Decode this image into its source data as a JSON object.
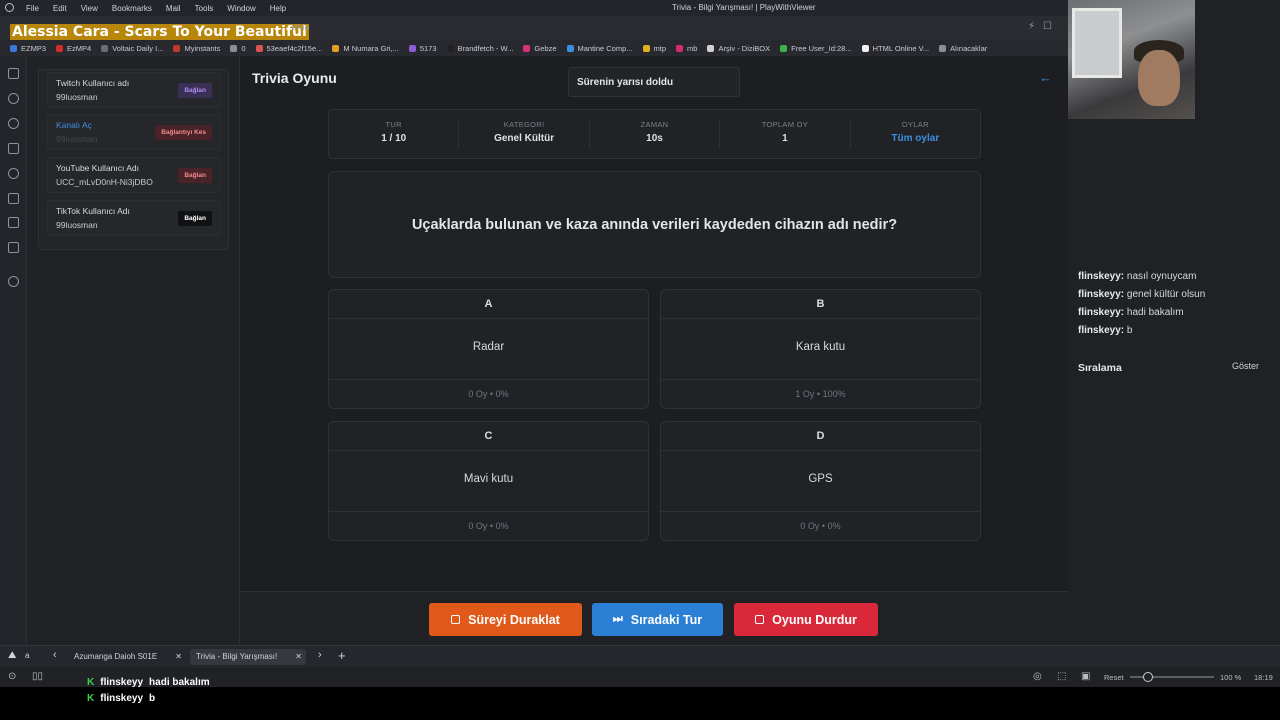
{
  "window": {
    "menu": [
      "File",
      "Edit",
      "View",
      "Bookmarks",
      "Mail",
      "Tools",
      "Window",
      "Help"
    ],
    "title": "Trivia - Bilgi Yarışması! | PlayWithViewer"
  },
  "address_bar": {
    "now_playing": "Alessia Cara - Scars To Your Beautiful",
    "url_fragment": "trivia"
  },
  "bookmarks": [
    {
      "label": "EZMP3",
      "color": "#3b7ad9"
    },
    {
      "label": "EzMP4",
      "color": "#d62b2b"
    },
    {
      "label": "Voltaic Daily I...",
      "color": "#6a6f78"
    },
    {
      "label": "Myinstants",
      "color": "#c0392b"
    },
    {
      "label": "0",
      "color": "#8a8f96"
    },
    {
      "label": "53eaef4c2f15e...",
      "color": "#d9534f"
    },
    {
      "label": "M Numara Gri,...",
      "color": "#e3a020"
    },
    {
      "label": "5173",
      "color": "#8e5bd9"
    },
    {
      "label": "Brandfetch - W...",
      "color": "#222"
    },
    {
      "label": "Gebze",
      "color": "#d6317b"
    },
    {
      "label": "Mantine Comp...",
      "color": "#3b8ee0"
    },
    {
      "label": "mtp",
      "color": "#e0b020"
    },
    {
      "label": "mb",
      "color": "#d62b6a"
    },
    {
      "label": "Arşiv - DiziBOX",
      "color": "#d0d0d0"
    },
    {
      "label": "Free User_Id:28...",
      "color": "#3fb24b"
    },
    {
      "label": "HTML Online V...",
      "color": "#f0f0f0"
    },
    {
      "label": "Alınacaklar",
      "color": "#8a8f96"
    }
  ],
  "connections": [
    {
      "title": "Twitch Kullanıcı adı",
      "value": "99luosman",
      "button": "Bağlan",
      "btn_bg": "#3a2f55",
      "btn_fg": "#b28cf5",
      "title_color": "#d8dbe0"
    },
    {
      "title": "Kanalı Aç",
      "value": "99luosman",
      "button": "Bağlantıyı Kes",
      "btn_bg": "#4a2328",
      "btn_fg": "#f08a8a",
      "title_color": "#3e8fe0"
    },
    {
      "title": "YouTube Kullanıcı Adı",
      "value": "UCC_mLvD0nH-Ni3jDBO",
      "button": "Bağlan",
      "btn_bg": "#4a2328",
      "btn_fg": "#f08a8a",
      "title_color": "#d8dbe0"
    },
    {
      "title": "TikTok Kullanıcı Adı",
      "value": "99luosman",
      "button": "Bağlan",
      "btn_bg": "#101113",
      "btn_fg": "#ffffff",
      "title_color": "#d8dbe0"
    }
  ],
  "page": {
    "title": "Trivia Oyunu",
    "toast": "Sürenin yarısı doldu"
  },
  "stats": [
    {
      "label": "TUR",
      "value": "1 / 10"
    },
    {
      "label": "KATEGORI",
      "value": "Genel Kültür"
    },
    {
      "label": "ZAMAN",
      "value": "10s"
    },
    {
      "label": "TOPLAM OY",
      "value": "1"
    },
    {
      "label": "OYLAR",
      "value": "Tüm oylar"
    }
  ],
  "question": "Uçaklarda bulunan ve kaza anında verileri kaydeden cihazın adı nedir?",
  "answers": [
    {
      "letter": "A",
      "text": "Radar",
      "votes": "0 Oy • 0%"
    },
    {
      "letter": "B",
      "text": "Kara kutu",
      "votes": "1 Oy • 100%"
    },
    {
      "letter": "C",
      "text": "Mavi kutu",
      "votes": "0 Oy • 0%"
    },
    {
      "letter": "D",
      "text": "GPS",
      "votes": "0 Oy • 0%"
    }
  ],
  "actions": {
    "pause": "Süreyi Duraklat",
    "next": "Sıradaki Tur",
    "stop": "Oyunu Durdur",
    "colors": {
      "pause": "#e0591a",
      "next": "#2b7fd4",
      "stop": "#d9283a"
    }
  },
  "chat": {
    "messages": [
      {
        "user": "flinskeyy:",
        "text": "nasıl oynuycam"
      },
      {
        "user": "flinskeyy:",
        "text": "genel kültür olsun"
      },
      {
        "user": "flinskeyy:",
        "text": "hadi bakalım"
      },
      {
        "user": "flinskeyy:",
        "text": "b"
      }
    ],
    "ranking_title": "Sıralama",
    "ranking_show": "Göster"
  },
  "tabs": [
    {
      "label": "Azumanga Daioh S01E"
    },
    {
      "label": "Trivia - Bilgi Yarışması!"
    }
  ],
  "status": {
    "left_label": "a",
    "reset": "Reset",
    "zoom": "100 %",
    "time": "18:19"
  },
  "overlay": [
    {
      "user": "flinskeyy",
      "text": "hadi bakalım"
    },
    {
      "user": "flinskeyy",
      "text": "b"
    }
  ]
}
